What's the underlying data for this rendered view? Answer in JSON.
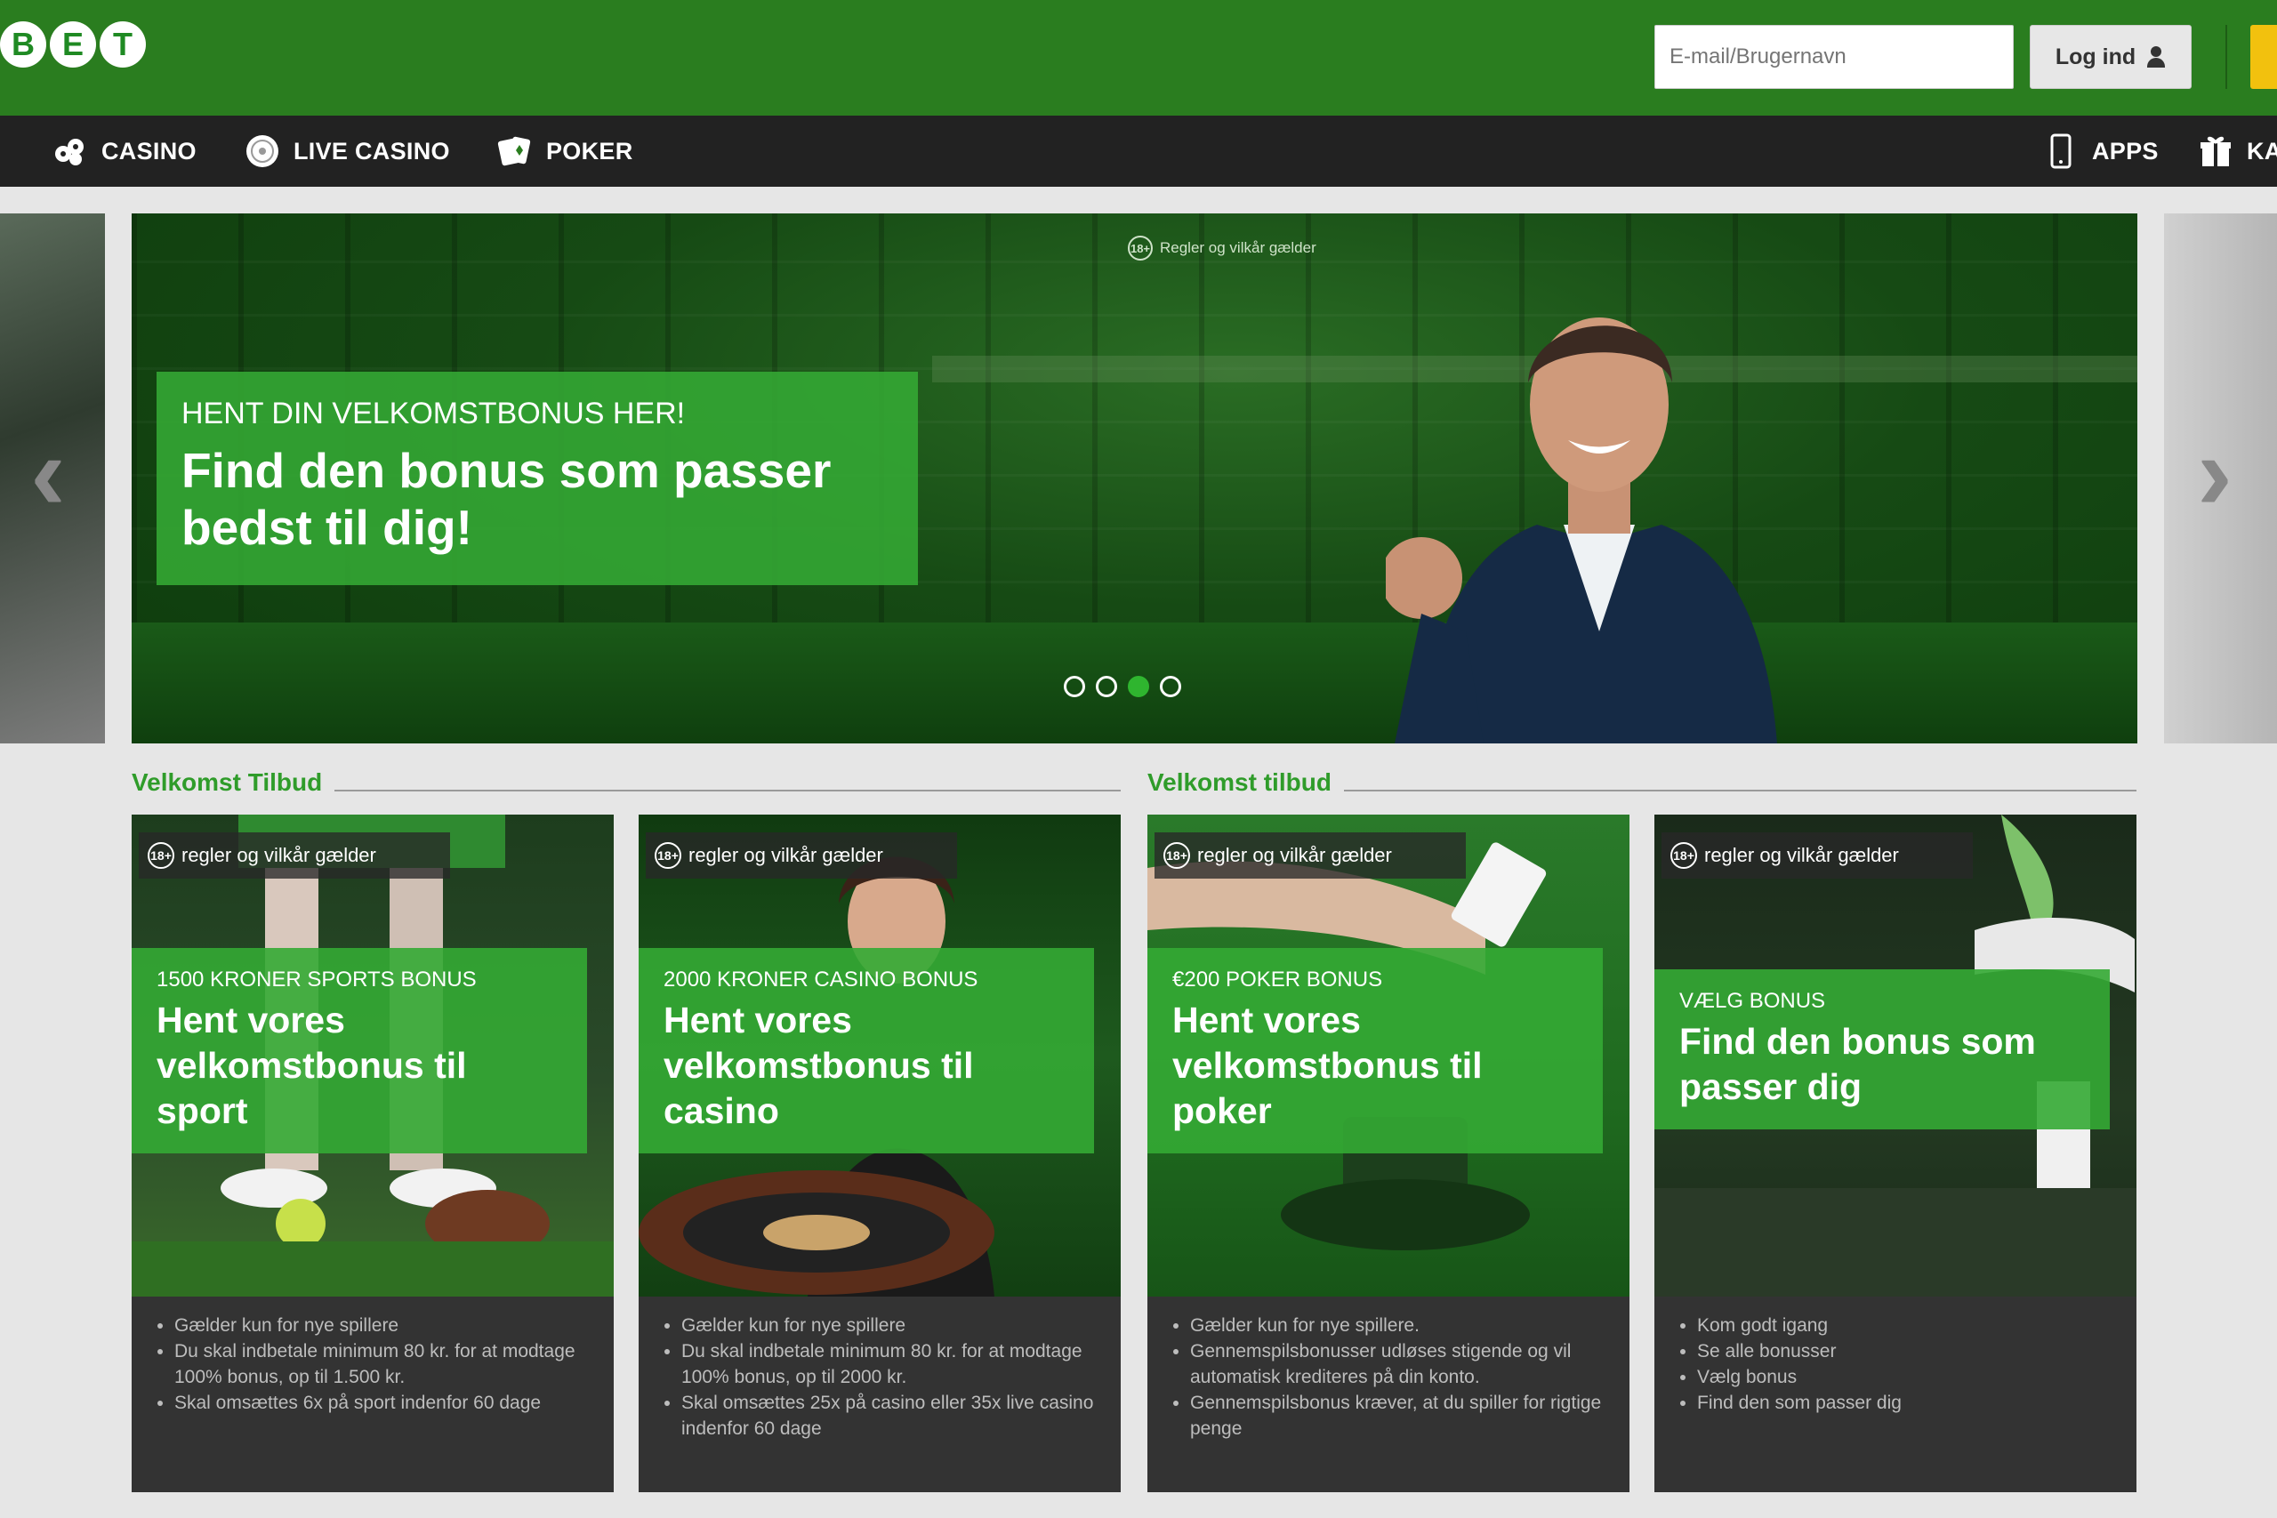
{
  "header": {
    "logo_letters": [
      "B",
      "E",
      "T"
    ],
    "login": {
      "placeholder": "E-mail/Brugernavn",
      "button_label": "Log ind"
    }
  },
  "nav": {
    "left": [
      {
        "label": "CASINO",
        "icon": "casino-icon"
      },
      {
        "label": "LIVE CASINO",
        "icon": "roulette-icon"
      },
      {
        "label": "POKER",
        "icon": "cards-icon"
      }
    ],
    "right": [
      {
        "label": "APPS",
        "icon": "phone-icon"
      },
      {
        "label": "KA",
        "icon": "gift-icon"
      }
    ]
  },
  "hero": {
    "terms_badge": "18+",
    "terms_text": "Regler og vilkår gælder",
    "eyebrow": "HENT DIN VELKOMSTBONUS HER!",
    "title": "Find den bonus som passer bedst til dig!",
    "slides": {
      "count": 4,
      "active_index": 2
    },
    "colors": {
      "box": "#34aa34",
      "accent": "#2fb52f"
    }
  },
  "sections": [
    {
      "title": "Velkomst Tilbud"
    },
    {
      "title": "Velkomst tilbud"
    }
  ],
  "cards": [
    {
      "badge": "18+",
      "terms": "regler og vilkår gælder",
      "eyebrow": "1500 KRONER SPORTS BONUS",
      "title": "Hent vores velkomstbonus til sport",
      "bullets": [
        "Gælder kun for nye spillere",
        "Du skal indbetale minimum 80 kr. for at modtage 100% bonus, op til 1.500 kr.",
        "Skal omsættes 6x på sport indenfor 60 dage"
      ]
    },
    {
      "badge": "18+",
      "terms": "regler og vilkår gælder",
      "eyebrow": "2000 KRONER CASINO BONUS",
      "title": "Hent vores velkomstbonus til casino",
      "bullets": [
        "Gælder kun for nye spillere",
        "Du skal indbetale minimum 80 kr. for at modtage 100% bonus, op til 2000 kr.",
        "Skal omsættes 25x på casino eller 35x live casino indenfor 60 dage"
      ]
    },
    {
      "badge": "18+",
      "terms": "regler og vilkår gælder",
      "eyebrow": "€200 POKER BONUS",
      "title": "Hent vores velkomstbonus til poker",
      "bullets": [
        "Gælder kun for nye spillere.",
        "Gennemspilsbonusser udløses stigende og vil automatisk krediteres på din konto.",
        "Gennemspilsbonus kræver, at du spiller for rigtige penge"
      ]
    },
    {
      "badge": "18+",
      "terms": "regler og vilkår gælder",
      "eyebrow": "VÆLG BONUS",
      "title": "Find den bonus som passer dig",
      "bullets": [
        "Kom godt igang",
        "Se alle bonusser",
        "Vælg bonus",
        "Find den som passer dig"
      ]
    }
  ]
}
